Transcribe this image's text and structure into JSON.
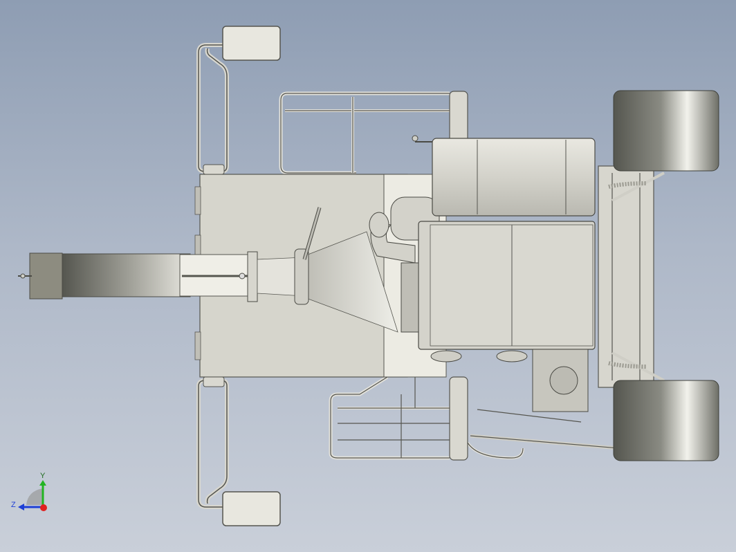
{
  "viewport": {
    "background_top": "#8e9db3",
    "background_bottom": "#c9cfd9"
  },
  "model": {
    "body_color": "#d6d5cc",
    "metal_color": "#c8c7be",
    "tire_color": "#5b5c55",
    "edge_color": "#4a4a44"
  },
  "triad": {
    "x_color": "#e02020",
    "y_color": "#22b422",
    "z_color": "#1d3fd6",
    "y_label": "Y",
    "z_label": "Z"
  }
}
